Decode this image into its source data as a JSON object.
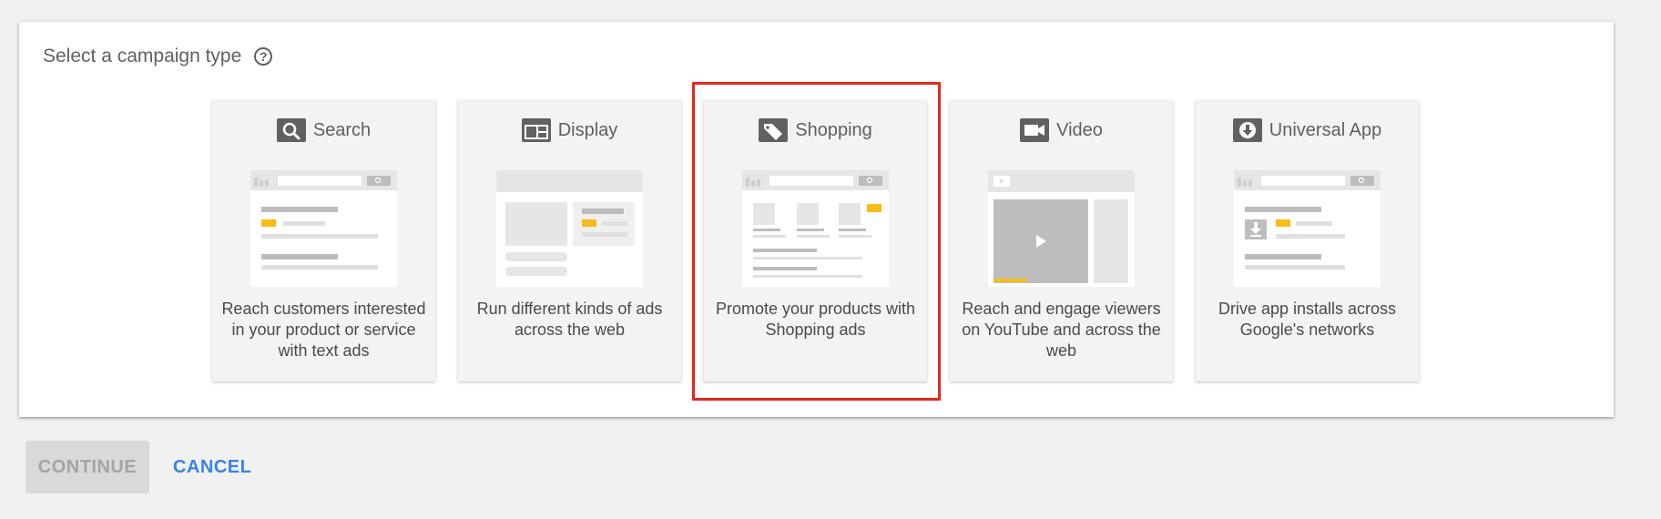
{
  "header": {
    "title": "Select a campaign type",
    "help_icon": "help-circle-icon"
  },
  "cards": [
    {
      "id": "search",
      "icon": "search-icon",
      "label": "Search",
      "description": "Reach customers interested in your product or service with text ads"
    },
    {
      "id": "display",
      "icon": "display-icon",
      "label": "Display",
      "description": "Run different kinds of ads across the web"
    },
    {
      "id": "shopping",
      "icon": "tag-icon",
      "label": "Shopping",
      "description": "Promote your products with Shopping ads",
      "highlighted": true
    },
    {
      "id": "video",
      "icon": "video-camera-icon",
      "label": "Video",
      "description": "Reach and engage viewers on YouTube and across the web"
    },
    {
      "id": "universal_app",
      "icon": "download-icon",
      "label": "Universal App",
      "description": "Drive app installs across Google's networks"
    }
  ],
  "actions": {
    "continue_label": "CONTINUE",
    "continue_disabled": true,
    "cancel_label": "CANCEL"
  },
  "colors": {
    "accent": "#3b82e6",
    "highlight": "#e5261f",
    "ad_marker": "#f9bc15"
  }
}
